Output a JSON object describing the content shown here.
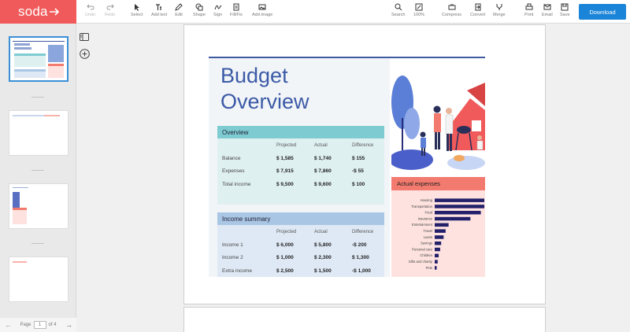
{
  "app": {
    "logo": "soda",
    "download_label": "Download"
  },
  "toolbar": {
    "undo": "Undo",
    "redo": "Redo",
    "select": "Select",
    "add_text": "Add text",
    "edit": "Edit",
    "shape": "Shape",
    "sign": "Sign",
    "fill_in": "Fill/Fix",
    "add_image": "Add image",
    "search": "Search",
    "zoom": "100%",
    "compress": "Compress",
    "convert": "Convert",
    "merge": "Merge",
    "print": "Print",
    "email": "Email",
    "save": "Save"
  },
  "pager": {
    "label": "Page",
    "current": "1",
    "of_total": "of 4"
  },
  "document": {
    "title_line1": "Budget",
    "title_line2": "Overview",
    "overview": {
      "heading": "Overview",
      "columns": [
        "",
        "Projected",
        "Actual",
        "Difference"
      ],
      "rows": [
        [
          "Balance",
          "$ 1,585",
          "$ 1,740",
          "$ 155"
        ],
        [
          "Expenses",
          "$ 7,915",
          "$ 7,860",
          "-$ 55"
        ],
        [
          "Total income",
          "$ 9,500",
          "$ 9,600",
          "$ 100"
        ]
      ]
    },
    "income": {
      "heading": "Income summary",
      "columns": [
        "",
        "Projected",
        "Actual",
        "Difference"
      ],
      "rows": [
        [
          "Income 1",
          "$ 6,000",
          "$ 5,800",
          "-$ 200"
        ],
        [
          "Income 2",
          "$ 1,000",
          "$ 2,300",
          "$ 1,300"
        ],
        [
          "Extra income",
          "$ 2,500",
          "$ 1,500",
          "-$ 1,000"
        ]
      ]
    },
    "expenses_heading": "Actual expenses"
  },
  "chart_data": {
    "type": "bar",
    "orientation": "horizontal",
    "title": "Actual expenses",
    "categories": [
      "Housing",
      "Transportation",
      "Food",
      "Insurance",
      "Entertainment",
      "Travel",
      "Loans",
      "Savings",
      "Personal care",
      "Children",
      "Gifts and charity",
      "Pets"
    ],
    "values": [
      1000,
      1000,
      930,
      720,
      280,
      220,
      180,
      130,
      110,
      80,
      60,
      40
    ],
    "bar_color": "#22206b"
  },
  "colors": {
    "brand": "#f15a5a",
    "accent": "#1a84d8",
    "overview_header": "#7ecbd2",
    "income_header": "#a9c6e5",
    "expenses_header": "#f27a6e",
    "title": "#3b5aa6"
  }
}
